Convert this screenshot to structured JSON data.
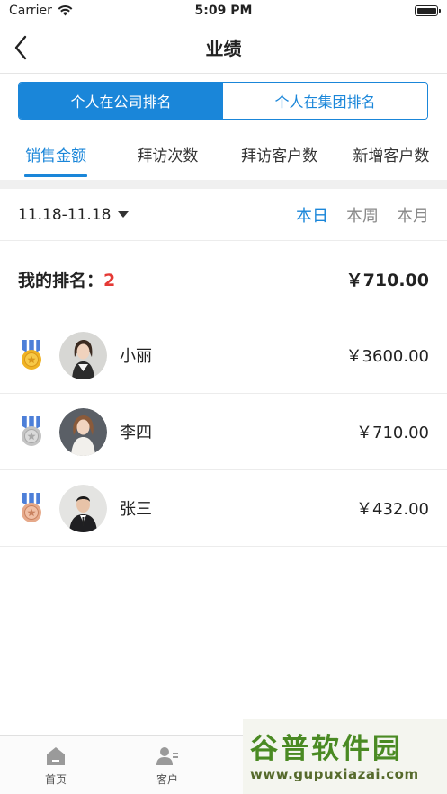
{
  "status_bar": {
    "carrier": "Carrier",
    "time": "5:09 PM"
  },
  "nav": {
    "title": "业绩"
  },
  "segment": {
    "items": [
      "个人在公司排名",
      "个人在集团排名"
    ],
    "selected_index": 0
  },
  "metric_tabs": {
    "items": [
      "销售金额",
      "拜访次数",
      "拜访客户数",
      "新增客户数"
    ],
    "selected_index": 0
  },
  "filter": {
    "date_range": "11.18-11.18",
    "periods": [
      "本日",
      "本周",
      "本月"
    ],
    "selected_index": 0
  },
  "my_rank": {
    "label": "我的排名：",
    "rank": "2",
    "amount": "￥710.00"
  },
  "ranking": [
    {
      "medal": "gold-medal-icon",
      "name": "小丽",
      "amount": "￥3600.00"
    },
    {
      "medal": "silver-medal-icon",
      "name": "李四",
      "amount": "￥710.00"
    },
    {
      "medal": "bronze-medal-icon",
      "name": "张三",
      "amount": "￥432.00"
    }
  ],
  "tab_bar": {
    "items": [
      {
        "label": "首页",
        "icon": "home-icon"
      },
      {
        "label": "客户",
        "icon": "customer-icon"
      }
    ]
  },
  "watermark": {
    "title": "谷普软件园",
    "url": "www.gupuxiazai.com"
  },
  "colors": {
    "accent": "#1a86d9",
    "rank_highlight": "#e53935",
    "gold": "#f0b323",
    "silver": "#c4c4c4",
    "bronze": "#e6a98a",
    "ribbon": "#4d7fd8"
  }
}
